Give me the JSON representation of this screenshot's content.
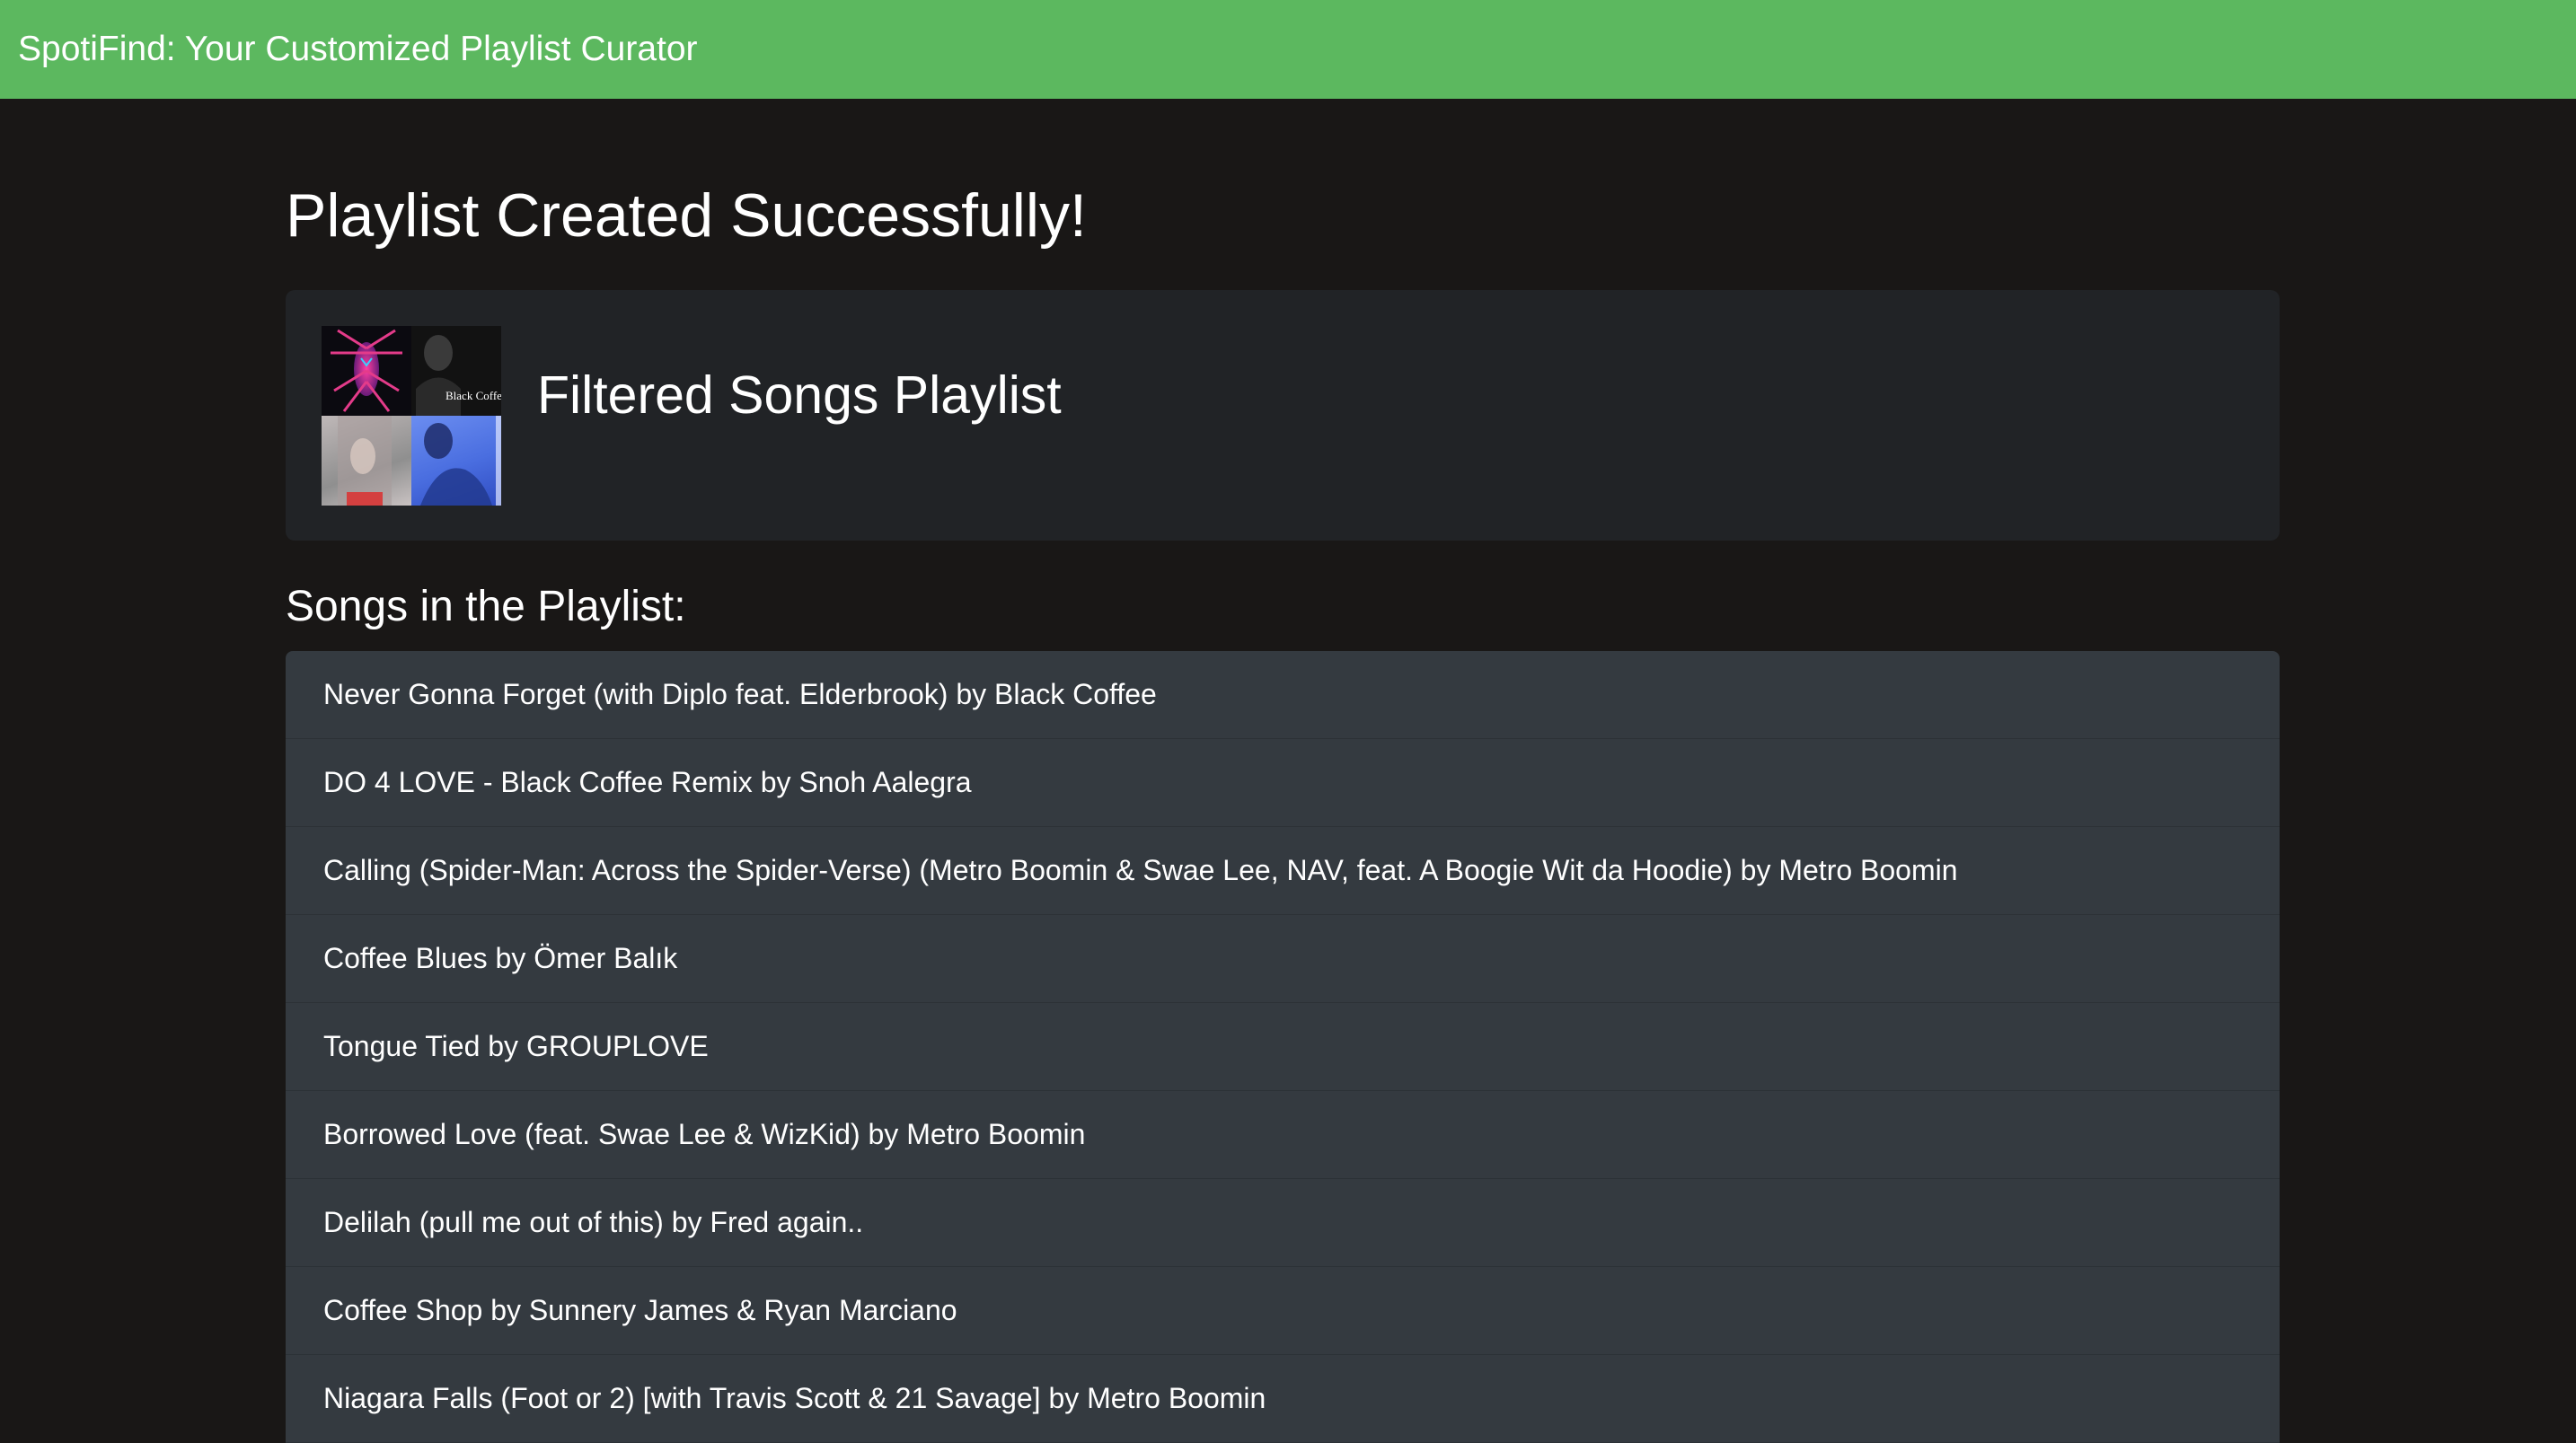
{
  "navbar": {
    "brand": "SpotiFind: Your Customized Playlist Curator",
    "color": "#5cb85f"
  },
  "main": {
    "title": "Playlist Created Successfully!",
    "playlist": {
      "name": "Filtered Songs Playlist",
      "cover_text": "Black Coffee"
    },
    "songs_heading": "Songs in the Playlist:",
    "songs": [
      "Never Gonna Forget (with Diplo feat. Elderbrook) by Black Coffee",
      "DO 4 LOVE - Black Coffee Remix by Snoh Aalegra",
      "Calling (Spider-Man: Across the Spider-Verse) (Metro Boomin & Swae Lee, NAV, feat. A Boogie Wit da Hoodie) by Metro Boomin",
      "Coffee Blues by Ömer Balık",
      "Tongue Tied by GROUPLOVE",
      "Borrowed Love (feat. Swae Lee & WizKid) by Metro Boomin",
      "Delilah (pull me out of this) by Fred again..",
      "Coffee Shop by Sunnery James & Ryan Marciano",
      "Niagara Falls (Foot or 2) [with Travis Scott & 21 Savage] by Metro Boomin"
    ]
  },
  "colors": {
    "background": "#191716",
    "card": "#212326",
    "list_item": "#343a40"
  }
}
